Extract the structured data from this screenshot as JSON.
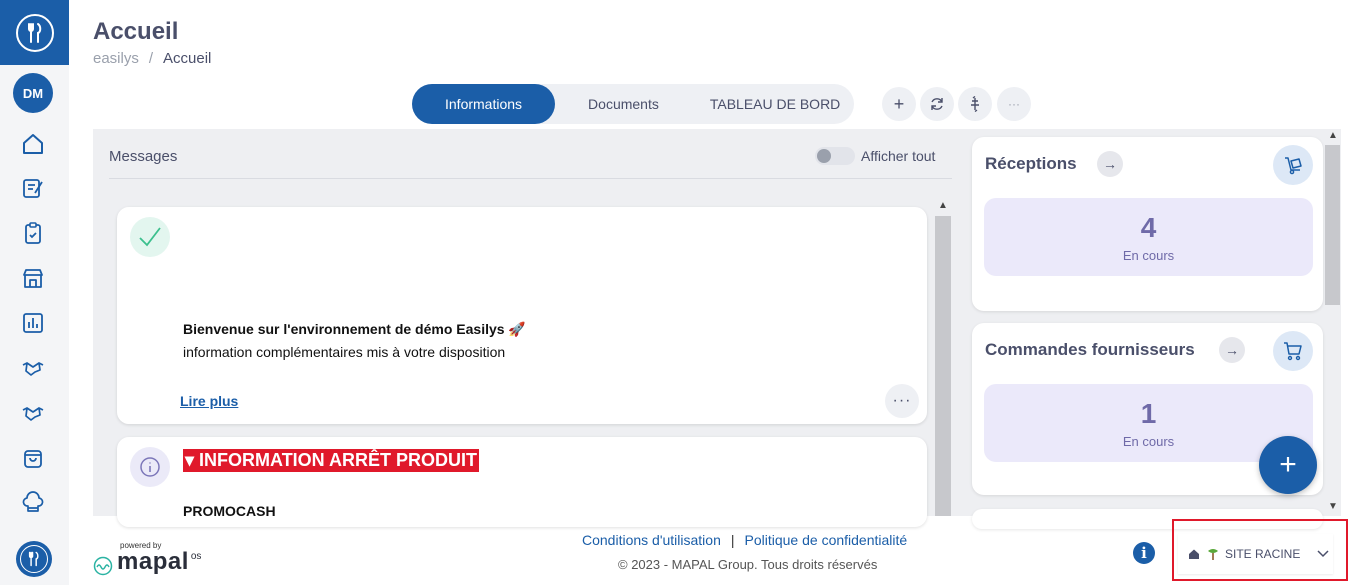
{
  "header": {
    "title": "Accueil",
    "breadcrumb": [
      "easilys",
      "Accueil"
    ]
  },
  "sidebar": {
    "avatar_initials": "DM",
    "items": [
      {
        "icon": "home-icon"
      },
      {
        "icon": "edit-document-icon"
      },
      {
        "icon": "clipboard-check-icon"
      },
      {
        "icon": "store-icon"
      },
      {
        "icon": "building-report-icon"
      },
      {
        "icon": "handshake-icon"
      },
      {
        "icon": "handshake-alt-icon"
      },
      {
        "icon": "shopping-bag-icon"
      },
      {
        "icon": "chef-hat-icon"
      }
    ]
  },
  "tabs": {
    "items": [
      "Informations",
      "Documents",
      "TABLEAU DE BORD"
    ],
    "active": "Informations",
    "tools": [
      "+",
      "↻",
      "⇅",
      "···"
    ]
  },
  "messages": {
    "title": "Messages",
    "toggle_label": "Afficher tout",
    "cards": [
      {
        "icon": "check-icon",
        "heading": "Bienvenue sur l'environnement de démo Easilys 🚀",
        "text": "information complémentaires mis à votre disposition",
        "link": "Lire plus",
        "more": "···"
      },
      {
        "icon": "info-icon",
        "banner": "▾ INFORMATION ARRÊT PRODUIT",
        "heading": "PROMOCASH"
      }
    ]
  },
  "widgets": [
    {
      "title": "Réceptions",
      "count": "4",
      "label": "En cours",
      "icon": "delivery-trolley-icon"
    },
    {
      "title": "Commandes fournisseurs",
      "count": "1",
      "label": "En cours",
      "icon": "cart-icon"
    }
  ],
  "fab_label": "+",
  "footer": {
    "powered_by": "powered by",
    "brand": "mapal",
    "brand_suffix": "os",
    "links": [
      "Conditions d'utilisation",
      "Politique de confidentialité"
    ],
    "copyright": "© 2023 - MAPAL Group. Tous droits réservés",
    "info_label": "i",
    "site": "SITE RACINE"
  },
  "colors": {
    "primary": "#1b5ea8",
    "alert": "#e0192b",
    "widget_box": "#ebe9fa"
  }
}
